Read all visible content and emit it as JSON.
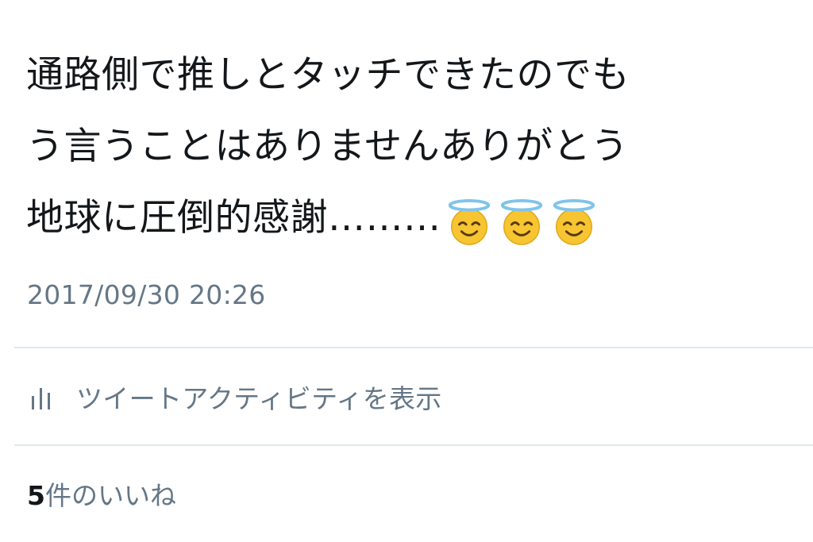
{
  "tweet": {
    "lines": [
      "通路側で推しとタッチできたのでも",
      "う言うことはありませんありがとう",
      "地球に圧倒的感謝………"
    ],
    "emoji": [
      "smiling-face-with-halo-icon",
      "smiling-face-with-halo-icon",
      "smiling-face-with-halo-icon"
    ],
    "timestamp": "2017/09/30 20:26"
  },
  "activity": {
    "icon": "bar-chart-icon",
    "label": "ツイートアクティビティを表示"
  },
  "likes": {
    "count": "5",
    "label": "件のいいね"
  },
  "colors": {
    "text": "#14171a",
    "secondary": "#657786",
    "divider": "#e1e8ed",
    "emoji_face": "#f7c531",
    "halo": "#7fc4ea"
  }
}
